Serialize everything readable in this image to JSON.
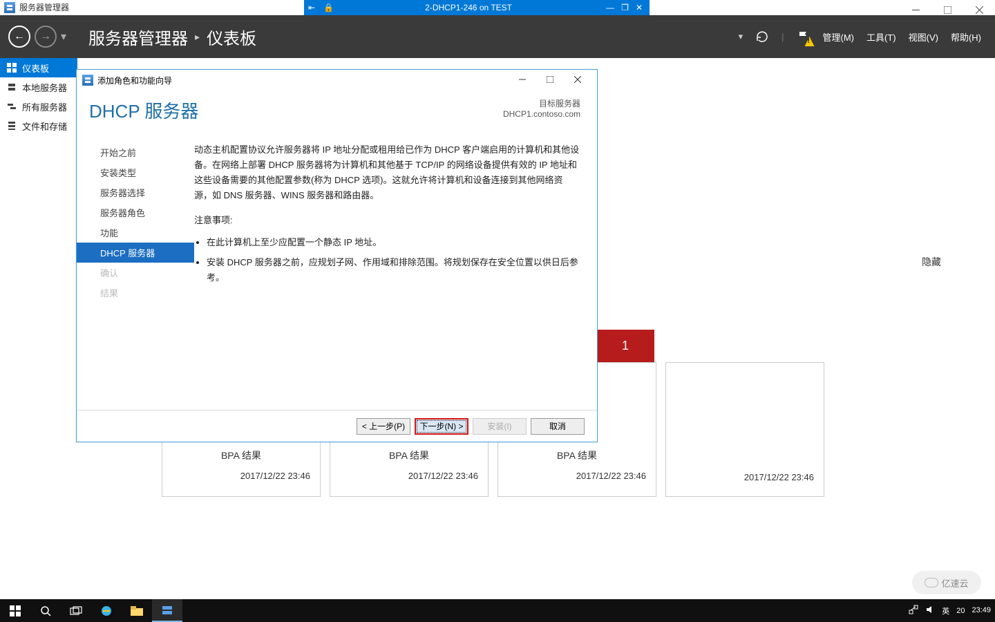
{
  "outerWindow": {
    "minimize": "—",
    "maximize": "□",
    "close": "✕"
  },
  "vmBar": {
    "title": "2-DHCP1-246 on TEST"
  },
  "serverManager": {
    "appTitle": "服务器管理器",
    "breadcrumb_root": "服务器管理器",
    "breadcrumb_page": "仪表板",
    "menu": {
      "manage": "管理(M)",
      "tools": "工具(T)",
      "view": "视图(V)",
      "help": "帮助(H)"
    },
    "nav": {
      "dashboard": "仪表板",
      "local": "本地服务器",
      "all": "所有服务器",
      "file": "文件和存储"
    },
    "hide": "隐藏",
    "redBadge": "1",
    "bpa": "BPA 结果",
    "timestamp": "2017/12/22 23:46"
  },
  "wizard": {
    "title": "添加角色和功能向导",
    "heading": "DHCP 服务器",
    "targetLabel": "目标服务器",
    "targetServer": "DHCP1.contoso.com",
    "steps": {
      "before": "开始之前",
      "installType": "安装类型",
      "serverSel": "服务器选择",
      "serverRoles": "服务器角色",
      "features": "功能",
      "dhcp": "DHCP 服务器",
      "confirm": "确认",
      "results": "结果"
    },
    "bodyText": "动态主机配置协议允许服务器将 IP 地址分配或租用给已作为 DHCP 客户端启用的计算机和其他设备。在网络上部署 DHCP 服务器将为计算机和其他基于 TCP/IP 的网络设备提供有效的 IP 地址和这些设备需要的其他配置参数(称为 DHCP 选项)。这就允许将计算机和设备连接到其他网络资源，如 DNS 服务器、WINS 服务器和路由器。",
    "noteHeading": "注意事项:",
    "note1": "在此计算机上至少应配置一个静态 IP 地址。",
    "note2": "安装 DHCP 服务器之前，应规划子网、作用域和排除范围。将规划保存在安全位置以供日后参考。",
    "buttons": {
      "prev": "< 上一步(P)",
      "next": "下一步(N) >",
      "install": "安装(I)",
      "cancel": "取消"
    }
  },
  "taskbar": {
    "ime": "英",
    "date_hint": "20",
    "time": "23:49"
  },
  "watermark": "亿速云"
}
